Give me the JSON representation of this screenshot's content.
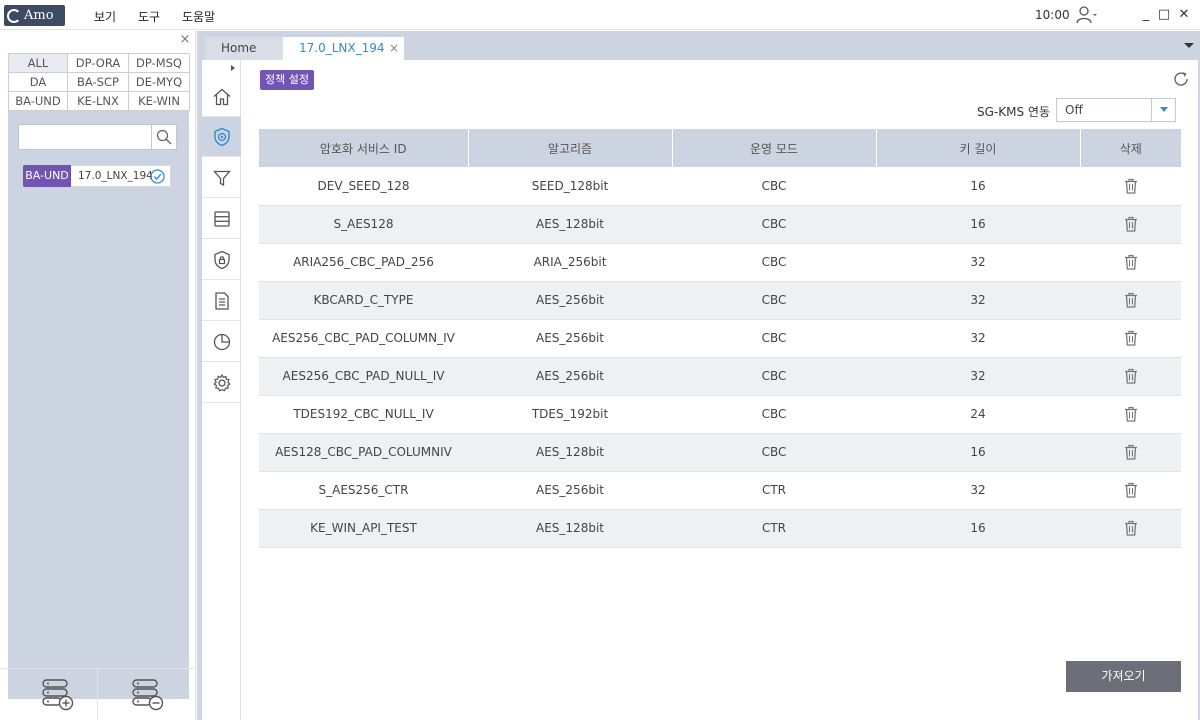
{
  "app": {
    "logo_text": "Amo"
  },
  "menu": {
    "items": [
      "보기",
      "도구",
      "도움말"
    ]
  },
  "titlebar": {
    "time": "10:00"
  },
  "window_controls": {
    "minimize": "_",
    "maximize": "□",
    "close": "✕"
  },
  "left_panel": {
    "close": "×",
    "filters": [
      "ALL",
      "DP-ORA",
      "DP-MSQ",
      "DA",
      "BA-SCP",
      "DE-MYQ",
      "BA-UND",
      "KE-LNX",
      "KE-WIN"
    ],
    "active_filter": "ALL",
    "search": {
      "value": "",
      "placeholder": ""
    },
    "server_tag": {
      "label": "BA-UND",
      "name": "17.0_LNX_194"
    }
  },
  "tabs": {
    "home": "Home",
    "active": "17.0_LNX_194",
    "close": "×"
  },
  "content": {
    "badge": "정책 설정",
    "kms": {
      "label": "SG-KMS 연동",
      "value": "Off"
    },
    "import_button": "가져오기"
  },
  "table": {
    "headers": [
      "암호화 서비스 ID",
      "알고리즘",
      "운영 모드",
      "키 길이",
      "삭제"
    ],
    "rows": [
      [
        "DEV_SEED_128",
        "SEED_128bit",
        "CBC",
        "16"
      ],
      [
        "S_AES128",
        "AES_128bit",
        "CBC",
        "16"
      ],
      [
        "ARIA256_CBC_PAD_256",
        "ARIA_256bit",
        "CBC",
        "32"
      ],
      [
        "KBCARD_C_TYPE",
        "AES_256bit",
        "CBC",
        "32"
      ],
      [
        "AES256_CBC_PAD_COLUMN_IV",
        "AES_256bit",
        "CBC",
        "32"
      ],
      [
        "AES256_CBC_PAD_NULL_IV",
        "AES_256bit",
        "CBC",
        "32"
      ],
      [
        "TDES192_CBC_NULL_IV",
        "TDES_192bit",
        "CBC",
        "24"
      ],
      [
        "AES128_CBC_PAD_COLUMNIV",
        "AES_128bit",
        "CBC",
        "16"
      ],
      [
        "S_AES256_CTR",
        "AES_256bit",
        "CTR",
        "32"
      ],
      [
        "KE_WIN_API_TEST",
        "AES_128bit",
        "CTR",
        "16"
      ]
    ]
  },
  "colors": {
    "accent_purple": "#7254b3",
    "tab_active_text": "#2e8bd2",
    "panel_bg": "#cdd4e1",
    "button_dark": "#6c6f78"
  }
}
